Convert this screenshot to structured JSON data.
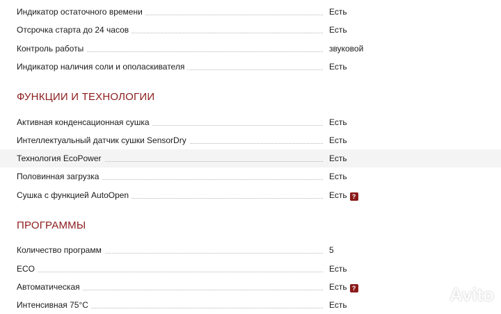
{
  "spec_rows_top": [
    {
      "label": "Индикатор остаточного времени",
      "value": "Есть"
    },
    {
      "label": "Отсрочка старта до 24 часов",
      "value": "Есть"
    },
    {
      "label": "Контроль работы",
      "value": "звуковой"
    },
    {
      "label": "Индикатор наличия соли и ополаскивателя",
      "value": "Есть"
    }
  ],
  "section_functions": {
    "title": "ФУНКЦИИ И ТЕХНОЛОГИИ",
    "rows": [
      {
        "label": "Активная конденсационная сушка",
        "value": "Есть"
      },
      {
        "label": "Интеллектуальный датчик сушки SensorDry",
        "value": "Есть"
      },
      {
        "label": "Технология EcoPower",
        "value": "Есть"
      },
      {
        "label": "Половинная загрузка",
        "value": "Есть"
      },
      {
        "label": "Сушка с функцией AutoOpen",
        "value": "Есть",
        "help": "?"
      }
    ]
  },
  "section_programs": {
    "title": "ПРОГРАММЫ",
    "rows": [
      {
        "label": "Количество программ",
        "value": "5"
      },
      {
        "label": "ECO",
        "value": "Есть"
      },
      {
        "label": "Автоматическая",
        "value": "Есть",
        "help": "?"
      },
      {
        "label": "Интенсивная 75°C",
        "value": "Есть"
      }
    ]
  },
  "watermark": {
    "text": "Avito"
  },
  "colors": {
    "accent": "#8b1a1a",
    "highlight_row": "#f4f4f4"
  },
  "icons": {
    "help": "question-mark-icon",
    "watermark": "avito-logo-icon"
  }
}
